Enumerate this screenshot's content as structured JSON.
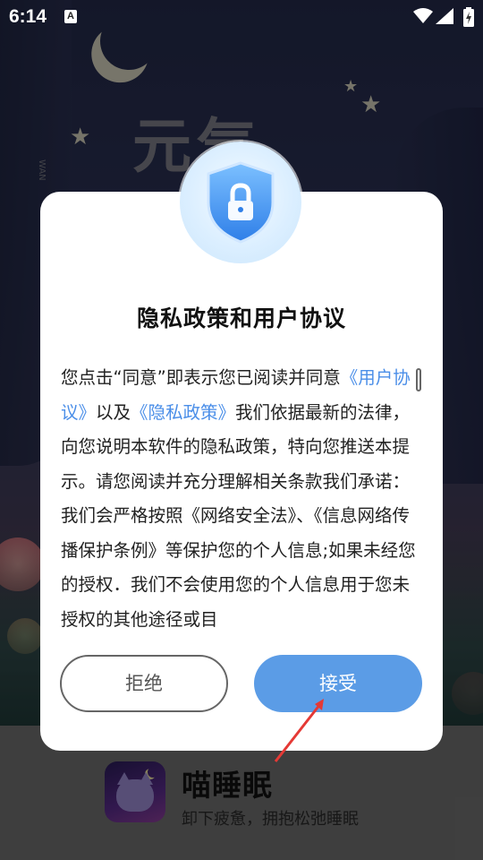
{
  "status_bar": {
    "time": "6:14",
    "notification_glyph": "A",
    "icons": [
      "wifi-icon",
      "signal-icon",
      "battery-charging-icon"
    ]
  },
  "background": {
    "title": "元气",
    "side_text": "WAN"
  },
  "dialog": {
    "icon": "shield-lock-icon",
    "title": "隐私政策和用户协议",
    "body_parts": {
      "p1": "您点击“同意”即表示您已阅读并同意",
      "user_agreement_link": "《用户协议》",
      "p2": "以及",
      "privacy_policy_link": "《隐私政策》",
      "p3": "我们依据最新的法律，向您说明本软件的隐私政策，特向您推送本提示。请您阅读并充分理解相关条款我们承诺：我们会严格按照《网络安全法》、《信息网络传播保护条例》等保护您的个人信息;如果未经您的授权．我们不会使用您的个人信息用于您未授权的其他途径或目"
    },
    "reject_label": "拒绝",
    "accept_label": "接受"
  },
  "app": {
    "name": "喵睡眠",
    "slogan": "卸下疲惫，拥抱松弛睡眠",
    "icon": "cat-moon-icon"
  },
  "colors": {
    "accent": "#5b9ce6",
    "link": "#4a8ee8",
    "annotation_arrow": "#e53935"
  }
}
